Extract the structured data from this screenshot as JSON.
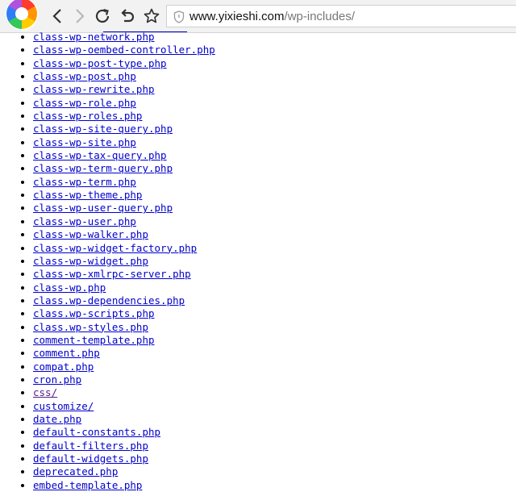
{
  "toolbar": {
    "logo_icon": "browser-logo-icon",
    "back_icon": "chevron-left-icon",
    "forward_icon": "chevron-right-icon",
    "reload_icon": "reload-icon",
    "undo_icon": "undo-icon",
    "favorite_icon": "star-icon",
    "url_host": "www.yixieshi.com",
    "url_path": "/wp-includes/",
    "security_icon": "shield-icon"
  },
  "listing": {
    "link_color": "#0000cc",
    "visited_color": "#551a8b",
    "items": [
      {
        "label": "class-wp-network.php",
        "visited": false
      },
      {
        "label": "class-wp-oembed-controller.php",
        "visited": false
      },
      {
        "label": "class-wp-post-type.php",
        "visited": false
      },
      {
        "label": "class-wp-post.php",
        "visited": false
      },
      {
        "label": "class-wp-rewrite.php",
        "visited": false
      },
      {
        "label": "class-wp-role.php",
        "visited": false
      },
      {
        "label": "class-wp-roles.php",
        "visited": false
      },
      {
        "label": "class-wp-site-query.php",
        "visited": false
      },
      {
        "label": "class-wp-site.php",
        "visited": false
      },
      {
        "label": "class-wp-tax-query.php",
        "visited": false
      },
      {
        "label": "class-wp-term-query.php",
        "visited": false
      },
      {
        "label": "class-wp-term.php",
        "visited": false
      },
      {
        "label": "class-wp-theme.php",
        "visited": false
      },
      {
        "label": "class-wp-user-query.php",
        "visited": false
      },
      {
        "label": "class-wp-user.php",
        "visited": false
      },
      {
        "label": "class-wp-walker.php",
        "visited": false
      },
      {
        "label": "class-wp-widget-factory.php",
        "visited": false
      },
      {
        "label": "class-wp-widget.php",
        "visited": false
      },
      {
        "label": "class-wp-xmlrpc-server.php",
        "visited": false
      },
      {
        "label": "class-wp.php",
        "visited": false
      },
      {
        "label": "class.wp-dependencies.php",
        "visited": false
      },
      {
        "label": "class.wp-scripts.php",
        "visited": false
      },
      {
        "label": "class.wp-styles.php",
        "visited": false
      },
      {
        "label": "comment-template.php",
        "visited": false
      },
      {
        "label": "comment.php",
        "visited": false
      },
      {
        "label": "compat.php",
        "visited": false
      },
      {
        "label": "cron.php",
        "visited": false
      },
      {
        "label": "css/",
        "visited": true
      },
      {
        "label": "customize/",
        "visited": false
      },
      {
        "label": "date.php",
        "visited": false
      },
      {
        "label": "default-constants.php",
        "visited": false
      },
      {
        "label": "default-filters.php",
        "visited": false
      },
      {
        "label": "default-widgets.php",
        "visited": false
      },
      {
        "label": "deprecated.php",
        "visited": false
      },
      {
        "label": "embed-template.php",
        "visited": false
      }
    ]
  }
}
